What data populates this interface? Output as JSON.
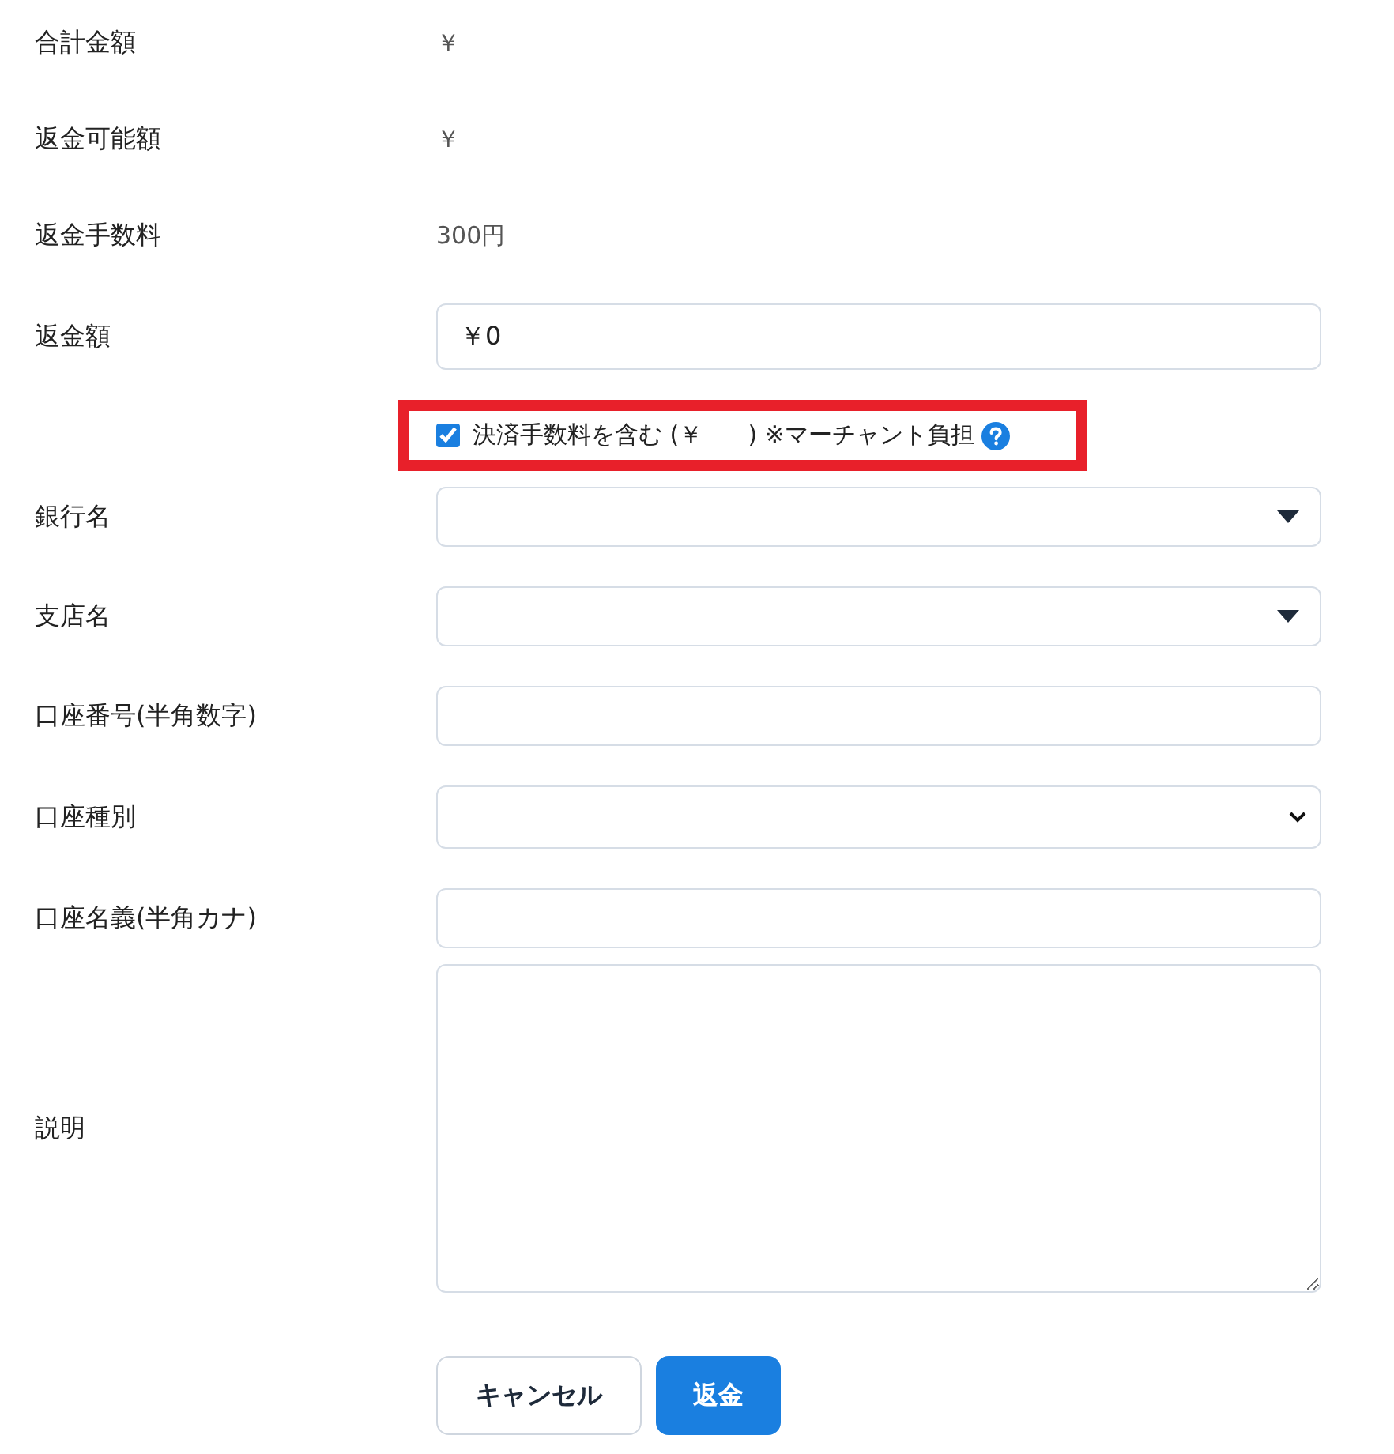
{
  "summary": [
    {
      "label": "合計金額",
      "value": "￥"
    },
    {
      "label": "返金可能額",
      "value": "￥"
    },
    {
      "label": "返金手数料",
      "value": "300円"
    }
  ],
  "amount": {
    "label": "返金額",
    "value": "￥0"
  },
  "fee_option": {
    "label": "決済手数料を含む (￥      ) ※マーチャント負担",
    "checked": true,
    "highlighted": true
  },
  "fields": [
    {
      "label": "銀行名",
      "kind": "dropdown"
    },
    {
      "label": "支店名",
      "kind": "dropdown"
    },
    {
      "label": "口座番号(半角数字)",
      "kind": "text"
    },
    {
      "label": "口座種別",
      "kind": "select"
    },
    {
      "label": "口座名義(半角カナ)",
      "kind": "text"
    },
    {
      "label": "説明",
      "kind": "textarea"
    }
  ],
  "buttons": [
    {
      "label": "キャンセル",
      "kind": "secondary"
    },
    {
      "label": "返金",
      "kind": "primary"
    }
  ]
}
